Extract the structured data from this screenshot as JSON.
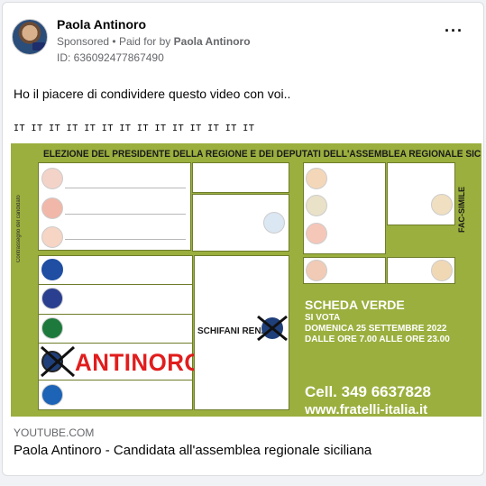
{
  "post": {
    "page_name": "Paola Antinoro",
    "sponsored": "Sponsored",
    "paid_for_prefix": "Paid for by",
    "paid_for_name": "Paola Antinoro",
    "ad_id": "ID: 636092477867490",
    "message": "Ho il piacere di condividere questo video con voi..",
    "flags": "IT IT IT IT IT IT IT IT IT IT IT IT IT IT",
    "more_icon": "more-options-icon"
  },
  "link_preview": {
    "domain": "YOUTUBE.COM",
    "title": "Paola Antinoro - Candidata all'assemblea regionale siciliana"
  },
  "ballot": {
    "title": "ELEZIONE DEL PRESIDENTE DELLA REGIONE E DEI DEPUTATI DELL'ASSEMBLEA REGIONALE SICILIANA",
    "side_label": "Contrassegno del candidato",
    "fac_simile": "FAC-SIMILE",
    "candidate_president": "SCHIFANI RENATO",
    "candidate_name": "ANTINORO",
    "scheda_title": "SCHEDA VERDE",
    "si_vota": "SI VOTA",
    "date": "DOMENICA 25 SETTEMBRE 2022",
    "hours": "DALLE ORE 7.00 ALLE ORE 23.00",
    "phone": "Cell. 349 6637828",
    "website": "www.fratelli-italia.it",
    "background_color": "#9aaf3e",
    "accent_red": "#e11d1d"
  }
}
